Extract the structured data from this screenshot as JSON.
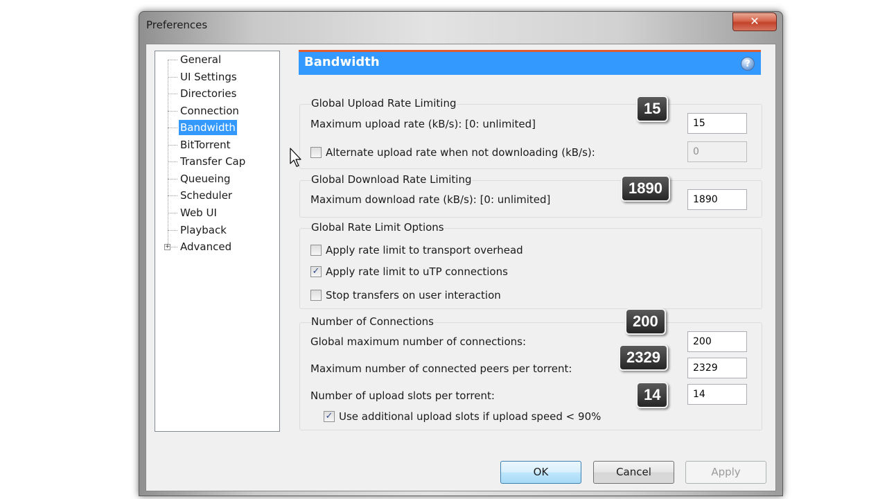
{
  "window": {
    "title": "Preferences",
    "close_glyph": "✕"
  },
  "tree": {
    "items": [
      {
        "label": "General"
      },
      {
        "label": "UI Settings"
      },
      {
        "label": "Directories"
      },
      {
        "label": "Connection"
      },
      {
        "label": "Bandwidth",
        "selected": true
      },
      {
        "label": "BitTorrent"
      },
      {
        "label": "Transfer Cap"
      },
      {
        "label": "Queueing"
      },
      {
        "label": "Scheduler"
      },
      {
        "label": "Web UI"
      },
      {
        "label": "Playback"
      },
      {
        "label": "Advanced",
        "expandable": true
      }
    ],
    "expander_glyph": "+"
  },
  "panel": {
    "title": "Bandwidth",
    "help_glyph": "?"
  },
  "upload_group": {
    "title": "Global Upload Rate Limiting",
    "max_label": "Maximum upload rate (kB/s): [0: unlimited]",
    "max_value": "15",
    "alt_label": "Alternate upload rate when not downloading (kB/s):",
    "alt_checked": false,
    "alt_value": "0"
  },
  "download_group": {
    "title": "Global Download Rate Limiting",
    "max_label": "Maximum download rate (kB/s): [0: unlimited]",
    "max_value": "1890"
  },
  "options_group": {
    "title": "Global Rate Limit Options",
    "overhead_label": "Apply rate limit to transport overhead",
    "overhead_checked": false,
    "utp_label": "Apply rate limit to uTP connections",
    "utp_checked": true,
    "stop_label": "Stop transfers on user interaction",
    "stop_checked": false
  },
  "connections_group": {
    "title": "Number of Connections",
    "global_label": "Global maximum number of connections:",
    "global_value": "200",
    "peers_label": "Maximum number of connected peers per torrent:",
    "peers_value": "2329",
    "slots_label": "Number of upload slots per torrent:",
    "slots_value": "14",
    "extra_label": "Use additional upload slots if upload speed < 90%",
    "extra_checked": true
  },
  "callouts": {
    "upload": "15",
    "download": "1890",
    "global": "200",
    "peers": "2329",
    "slots": "14"
  },
  "check_glyph": "✓",
  "buttons": {
    "ok": "OK",
    "cancel": "Cancel",
    "apply": "Apply"
  },
  "colors": {
    "accent": "#3399ff",
    "header_border": "#e05a2f"
  }
}
